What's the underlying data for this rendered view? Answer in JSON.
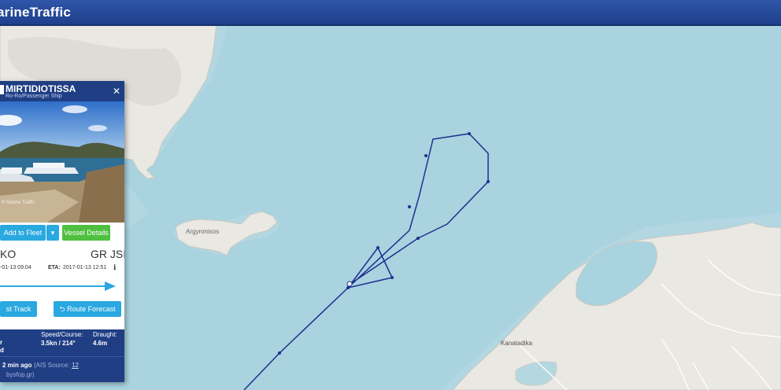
{
  "app": {
    "title": "MarineTraffic",
    "title_visible": "arineTraffic"
  },
  "map": {
    "labels": {
      "island": "Argyronisos",
      "town": "Kanatadika"
    },
    "colors": {
      "sea": "#a9d3df",
      "land": "#e9e8e3",
      "track": "#1f2f8f",
      "accent": "#1f3e84"
    }
  },
  "vessel_panel": {
    "name": "MIRTIDIOTISSA",
    "type": "Ro-Ro/Passenger Ship",
    "buttons": {
      "add_to_fleet": "Add to Fleet",
      "vessel_details": "Vessel Details",
      "past_track": "st Track",
      "route_forecast": "Route Forecast"
    },
    "origin": "KO",
    "destination": "GR JSI",
    "atd": "-01-13 09:04",
    "eta_label": "ETA:",
    "eta": "2017-01-13 12:51",
    "stats": {
      "status_value_1": "r",
      "status_value_2": "d",
      "speed_course_label": "Speed/Course:",
      "speed_course_value": "3.5kn / 214°",
      "draught_label": "Draught:",
      "draught_value": "4.6m"
    },
    "footer": {
      "age": "2 min ago",
      "source_text": "(AIS Source:",
      "source_link": "12",
      "source_site": "bysfop.gr)"
    },
    "icons": [
      "ship-type-icon",
      "close-icon",
      "caret-down-icon",
      "route-icon",
      "info-icon"
    ]
  }
}
